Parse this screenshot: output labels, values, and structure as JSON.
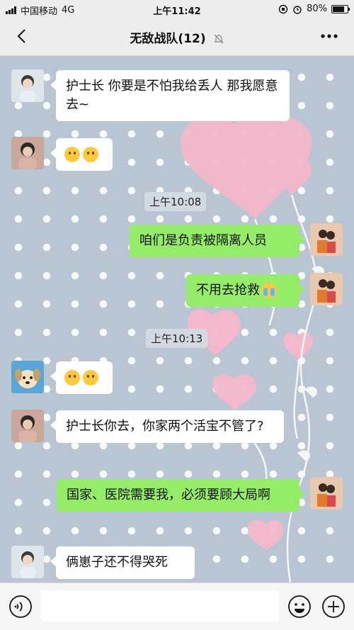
{
  "status_bar": {
    "carrier": "中国移动",
    "network": "4G",
    "time": "上午11:42",
    "battery": "80%",
    "battery_level": 0.8
  },
  "header": {
    "title": "无敌战队(12)",
    "back_icon": "chevron-left-icon",
    "mute_icon": "bell-off-icon",
    "more_icon": "more-icon"
  },
  "messages": [
    {
      "side": "in",
      "text": "护士长 你要是不怕我给丢人 那我愿意去~"
    },
    {
      "side": "in",
      "emoji": "thinking-face-emoji",
      "count": 2
    },
    {
      "timestamp": "上午10:08"
    },
    {
      "side": "out",
      "text": "咱们是负责被隔离人员"
    },
    {
      "side": "out",
      "text": "不用去抢救",
      "emoji": "crying-face-emoji"
    },
    {
      "timestamp": "上午10:13"
    },
    {
      "side": "in",
      "emoji": "thinking-face-emoji",
      "count": 2
    },
    {
      "side": "in",
      "text": "护士长你去，你家两个活宝不管了?"
    },
    {
      "side": "out",
      "text": "国家、医院需要我，必须要顾大局啊"
    },
    {
      "side": "in",
      "text": "俩崽子还不得哭死"
    }
  ],
  "colors": {
    "outgoing_bubble": "#95ec69",
    "incoming_bubble": "#ffffff",
    "chat_background": "#b9c5d2",
    "heart_pink": "#f4b8cc"
  }
}
